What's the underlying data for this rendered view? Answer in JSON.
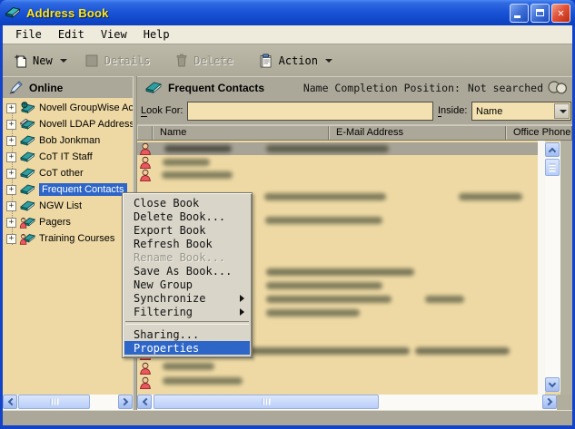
{
  "window": {
    "title": "Address Book"
  },
  "menubar": {
    "items": [
      {
        "label": "File"
      },
      {
        "label": "Edit"
      },
      {
        "label": "View"
      },
      {
        "label": "Help"
      }
    ]
  },
  "toolbar": {
    "new_label": "New",
    "details_label": "Details",
    "delete_label": "Delete",
    "action_label": "Action"
  },
  "left_panel": {
    "title": "Online",
    "tree_items": [
      {
        "label": "Novell GroupWise Ac"
      },
      {
        "label": "Novell LDAP Address"
      },
      {
        "label": "Bob Jonkman"
      },
      {
        "label": "CoT IT Staff"
      },
      {
        "label": "CoT other"
      },
      {
        "label": "Frequent Contacts"
      },
      {
        "label": "NGW List"
      },
      {
        "label": "Pagers"
      },
      {
        "label": "Training Courses"
      }
    ]
  },
  "right_panel": {
    "title": "Frequent Contacts",
    "name_completion_label": "Name Completion Position:",
    "name_completion_value": "Not searched",
    "look_for_label": "Look For:",
    "look_for_value": "",
    "inside_label": "Inside:",
    "inside_value": "Name",
    "columns": [
      {
        "label": "Name"
      },
      {
        "label": "E-Mail Address"
      },
      {
        "label": "Office Phone"
      }
    ]
  },
  "context_menu": {
    "items": [
      {
        "label": "Close Book",
        "state": "normal"
      },
      {
        "label": "Delete Book...",
        "state": "normal"
      },
      {
        "label": "Export Book",
        "state": "normal"
      },
      {
        "label": "Refresh Book",
        "state": "normal"
      },
      {
        "label": "Rename Book...",
        "state": "disabled"
      },
      {
        "label": "Save As Book...",
        "state": "normal"
      },
      {
        "label": "New Group",
        "state": "normal"
      },
      {
        "label": "Synchronize",
        "state": "normal",
        "submenu": true
      },
      {
        "label": "Filtering",
        "state": "normal",
        "submenu": true
      },
      {
        "label": "Sharing...",
        "state": "normal"
      },
      {
        "label": "Properties",
        "state": "highlighted"
      }
    ]
  },
  "colors": {
    "title_text": "#ffe71a",
    "selection_blue": "#2e66c8",
    "chrome_gray": "#aca899",
    "content_tan": "#eed9a4"
  }
}
